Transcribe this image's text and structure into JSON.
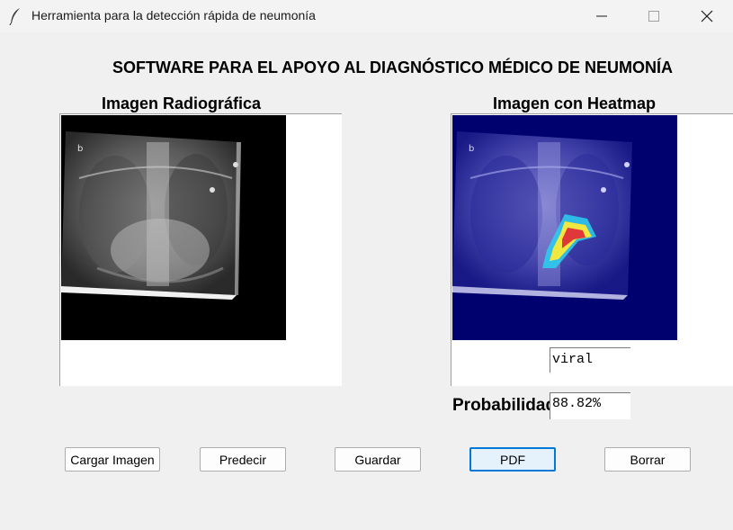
{
  "window": {
    "title": "Herramienta para la detección rápida de neumonía"
  },
  "main": {
    "heading": "SOFTWARE PARA EL APOYO AL DIAGNÓSTICO MÉDICO DE NEUMONÍA",
    "left_panel_title": "Imagen Radiográfica",
    "right_panel_title": "Imagen con Heatmap",
    "result_label": "viral",
    "probability_label": "Probabilidad:",
    "probability_value": "88.82%"
  },
  "buttons": {
    "load": "Cargar Imagen",
    "predict": "Predecir",
    "save": "Guardar",
    "pdf": "PDF",
    "clear": "Borrar"
  },
  "colors": {
    "accent": "#0078d7",
    "window_bg": "#f0f0f0",
    "heatmap_bg": "#00006e"
  },
  "icons": {
    "app": "feather-icon",
    "minimize": "minimize-icon",
    "maximize": "maximize-icon",
    "close": "close-icon"
  }
}
